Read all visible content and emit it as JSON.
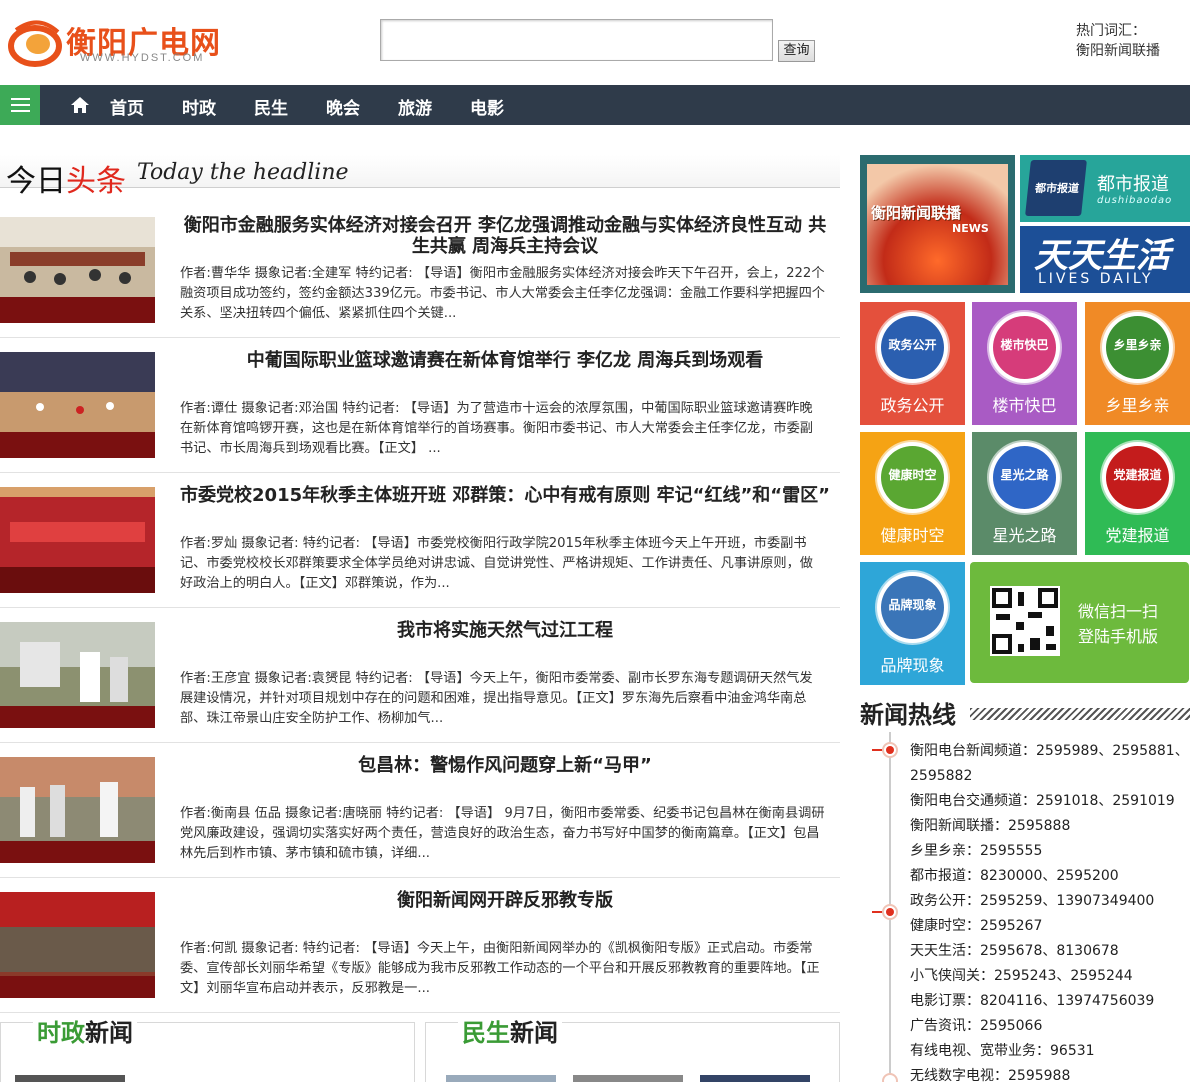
{
  "header": {
    "logo_text": "衡阳广电网",
    "logo_sub": "WWW.HYDST.COM",
    "search_button": "查询",
    "hot_label": "热门词汇：",
    "hot_link": "衡阳新闻联播"
  },
  "nav": {
    "items": [
      "首页",
      "时政",
      "民生",
      "晚会",
      "旅游",
      "电影"
    ]
  },
  "headline": {
    "cn_part1": "今日",
    "cn_part2": "头条",
    "en": "Today the headline"
  },
  "news": [
    {
      "title": "衡阳市金融服务实体经济对接会召开 李亿龙强调推动金融与实体经济良性互动 共生共赢 周海兵主持会议",
      "summary": "作者:曹华华 摄象记者:全建军 特约记者: 【导语】衡阳市金融服务实体经济对接会昨天下午召开，会上，222个融资项目成功签约，签约金额达339亿元。市委书记、市人大常委会主任李亿龙强调：金融工作要科学把握四个关系、坚决扭转四个偏低、紧紧抓住四个关键..."
    },
    {
      "title": "中葡国际职业篮球邀请赛在新体育馆举行 李亿龙 周海兵到场观看",
      "summary": "作者:谭仕 摄象记者:邓治国 特约记者: 【导语】为了营造市十运会的浓厚氛围，中葡国际职业篮球邀请赛昨晚在新体育馆鸣锣开赛，这也是在新体育馆举行的首场赛事。衡阳市委书记、市人大常委会主任李亿龙，市委副书记、市长周海兵到场观看比赛。【正文】 ..."
    },
    {
      "title": "市委党校2015年秋季主体班开班 邓群策：心中有戒有原则 牢记“红线”和“雷区”",
      "summary": "作者:罗灿 摄象记者: 特约记者: 【导语】市委党校衡阳行政学院2015年秋季主体班今天上午开班，市委副书记、市委党校校长邓群策要求全体学员绝对讲忠诚、自觉讲党性、严格讲规矩、工作讲责任、凡事讲原则，做好政治上的明白人。【正文】邓群策说，作为..."
    },
    {
      "title": "我市将实施天然气过江工程",
      "summary": "作者:王彦宜 摄象记者:袁赟昆 特约记者: 【导语】今天上午，衡阳市委常委、副市长罗东海专题调研天然气发展建设情况，并针对项目规划中存在的问题和困难，提出指导意见。【正文】罗东海先后察看中油金鸿华南总部、珠江帝景山庄安全防护工作、杨柳加气..."
    },
    {
      "title": "包昌林：警惕作风问题穿上新“马甲”",
      "summary": "作者:衡南县 伍品 摄象记者:唐晓丽 特约记者: 【导语】 9月7日，衡阳市委常委、纪委书记包昌林在衡南县调研党风廉政建设，强调切实落实好两个责任，营造良好的政治生态，奋力书写好中国梦的衡南篇章。【正文】包昌林先后到柞市镇、茅市镇和硫市镇，详细..."
    },
    {
      "title": "衡阳新闻网开辟反邪教专版",
      "summary": "作者:何凯 摄象记者: 特约记者: 【导语】今天上午，由衡阳新闻网举办的《凯枫衡阳专版》正式启动。市委常委、宣传部长刘丽华希望《专版》能够成为我市反邪教工作动态的一个平台和开展反邪教教育的重要阵地。【正文】刘丽华宣布启动并表示，反邪教是一..."
    }
  ],
  "sections": [
    {
      "accent": "时政",
      "rest": "新闻"
    },
    {
      "accent": "民生",
      "rest": "新闻"
    }
  ],
  "right": {
    "tv_text": "衡阳新闻联播",
    "tv_news": "NEWS",
    "dushi_chip": "都市报道",
    "dushi_title": "都市报道",
    "dushi_pinyin": "dushibaodao",
    "tiantian_title": "天天生活",
    "tiantian_en": "LIVES DAILY",
    "tiles": [
      {
        "label": "政务公开",
        "badge": "政务公开",
        "bg": "#e4503c",
        "inner": "#2b5fb0"
      },
      {
        "label": "楼市快巴",
        "badge": "楼市快巴",
        "bg": "#a95bc4",
        "inner": "#d63c7a"
      },
      {
        "label": "乡里乡亲",
        "badge": "乡里乡亲",
        "bg": "#f08a26",
        "inner": "#3c8f33"
      },
      {
        "label": "健康时空",
        "badge": "健康时空",
        "bg": "#f5a314",
        "inner": "#5aa732"
      },
      {
        "label": "星光之路",
        "badge": "星光之路",
        "bg": "#5b8b69",
        "inner": "#2f66c6"
      },
      {
        "label": "党建报道",
        "badge": "党建报道",
        "bg": "#2fbb55",
        "inner": "#c41c1c"
      },
      {
        "label": "品牌现象",
        "badge": "品牌现象",
        "bg": "#2ea6d8",
        "inner": "#3a75b8"
      }
    ],
    "wx_line1": "微信扫一扫",
    "wx_line2": "登陆手机版",
    "hotline_title": "新闻热线",
    "hotlines": [
      "衡阳电台新闻频道：2595989、2595881、2595882",
      "衡阳电台交通频道：2591018、2591019",
      "衡阳新闻联播：2595888",
      "乡里乡亲：2595555",
      "都市报道：8230000、2595200",
      "政务公开：2595259、13907349400",
      "健康时空：2595267",
      "天天生活：2595678、8130678",
      "小飞侠闯关：2595243、2595244",
      "电影订票：8204116、13974756039",
      "广告资讯：2595066",
      "有线电视、宽带业务：96531",
      "无线数字电视：2595988"
    ]
  },
  "colors": {
    "nav_bg": "#2f3b4a",
    "menu_bg": "#3daa57",
    "headline_accent": "#e0281d",
    "logo": "#e8501a"
  }
}
